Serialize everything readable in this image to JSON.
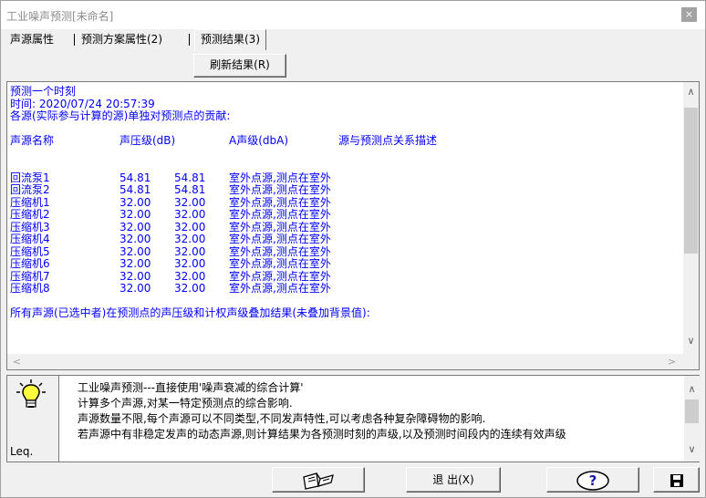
{
  "window": {
    "title": "工业噪声预测[未命名]",
    "close_glyph": "×"
  },
  "tabs": [
    {
      "label": "声源属性"
    },
    {
      "label": "预测方案属性(2)"
    },
    {
      "label": "预测结果(3)"
    }
  ],
  "toolbar": {
    "refresh_label": "刷新结果(R)"
  },
  "results": {
    "heading": "预测一个时刻",
    "time_line": "时间: 2020/07/24 20:57:39",
    "contrib_line": "各源(实际参与计算的源)单独对预测点的贡献:",
    "columns": [
      "声源名称",
      "声压级(dB)",
      "A声级(dbA)",
      "源与预测点关系描述"
    ],
    "rows": [
      {
        "name": "回流泵1",
        "spl": "54.81",
        "aspl": "54.81",
        "desc": "室外点源,测点在室外"
      },
      {
        "name": "回流泵2",
        "spl": "54.81",
        "aspl": "54.81",
        "desc": "室外点源,测点在室外"
      },
      {
        "name": "压缩机1",
        "spl": "32.00",
        "aspl": "32.00",
        "desc": "室外点源,测点在室外"
      },
      {
        "name": "压缩机2",
        "spl": "32.00",
        "aspl": "32.00",
        "desc": "室外点源,测点在室外"
      },
      {
        "name": "压缩机3",
        "spl": "32.00",
        "aspl": "32.00",
        "desc": "室外点源,测点在室外"
      },
      {
        "name": "压缩机4",
        "spl": "32.00",
        "aspl": "32.00",
        "desc": "室外点源,测点在室外"
      },
      {
        "name": "压缩机5",
        "spl": "32.00",
        "aspl": "32.00",
        "desc": "室外点源,测点在室外"
      },
      {
        "name": "压缩机6",
        "spl": "32.00",
        "aspl": "32.00",
        "desc": "室外点源,测点在室外"
      },
      {
        "name": "压缩机7",
        "spl": "32.00",
        "aspl": "32.00",
        "desc": "室外点源,测点在室外"
      },
      {
        "name": "压缩机8",
        "spl": "32.00",
        "aspl": "32.00",
        "desc": "室外点源,测点在室外"
      }
    ],
    "summary_line": "所有声源(已选中者)在预测点的声压级和计权声级叠加结果(未叠加背景值):"
  },
  "description": {
    "lines": [
      "工业噪声预测---直接使用'噪声衰减的综合计算'",
      "计算多个声源,对某一特定预测点的综合影响.",
      "声源数量不限,每个声源可以不同类型,不同发声特性,可以考虑各种复杂障碍物的影响.",
      "若声源中有非稳定发声的动态声源,则计算结果为各预测时刻的声级,以及预测时间段内的连续有效声级"
    ],
    "leq": "Leq."
  },
  "buttons": {
    "exit_label": "退 出(X)",
    "help_glyph": "?"
  },
  "scroll": {
    "up": "∧",
    "down": "∨",
    "left": "<",
    "right": ">"
  },
  "icons": {
    "book": "book-icon",
    "help": "help-icon",
    "save": "save-icon",
    "bulb": "lightbulb-icon"
  },
  "colors": {
    "result_text": "#0000ff",
    "help_blue": "#1a1aa6"
  }
}
